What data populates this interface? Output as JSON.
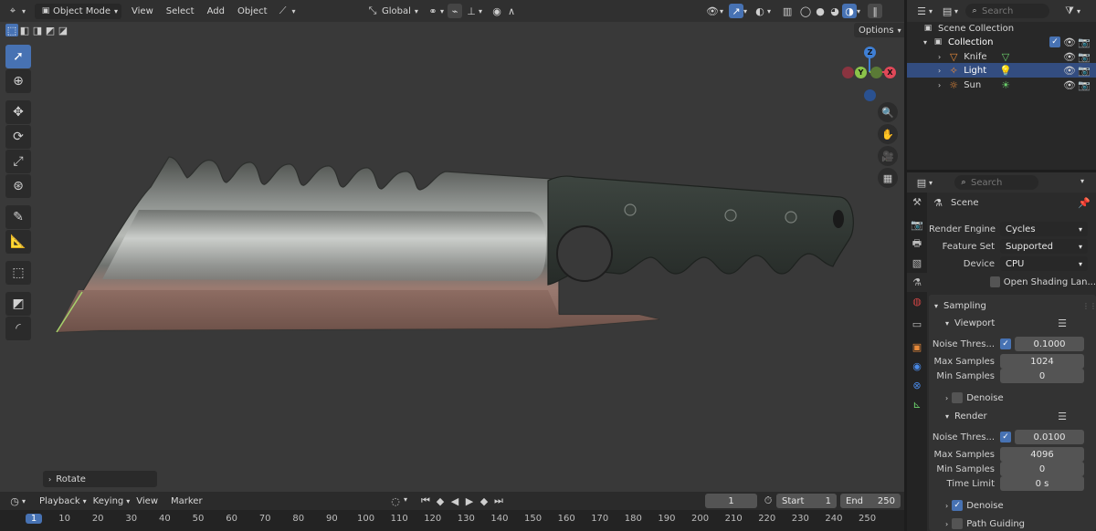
{
  "viewport": {
    "header": {
      "mode_label": "Object Mode",
      "menus": [
        "View",
        "Select",
        "Add",
        "Object"
      ],
      "orientation_label": "Global"
    },
    "options_label": "Options",
    "last_operation": "Rotate"
  },
  "timeline": {
    "menus": [
      "Playback",
      "Keying",
      "View",
      "Marker"
    ],
    "current_frame": "1",
    "start_label": "Start",
    "start_value": "1",
    "end_label": "End",
    "end_value": "250",
    "ruler_ticks": [
      "1",
      "10",
      "20",
      "30",
      "40",
      "50",
      "60",
      "70",
      "80",
      "90",
      "100",
      "110",
      "120",
      "130",
      "140",
      "150",
      "160",
      "170",
      "180",
      "190",
      "200",
      "210",
      "220",
      "230",
      "240",
      "250"
    ]
  },
  "outliner": {
    "search_placeholder": "Search",
    "scene_collection": "Scene Collection",
    "collection": "Collection",
    "items": [
      {
        "name": "Knife",
        "selected": false
      },
      {
        "name": "Light",
        "selected": true
      },
      {
        "name": "Sun",
        "selected": false
      }
    ]
  },
  "properties": {
    "search_placeholder": "Search",
    "scene_title": "Scene",
    "render_engine_label": "Render Engine",
    "render_engine_value": "Cycles",
    "feature_set_label": "Feature Set",
    "feature_set_value": "Supported",
    "device_label": "Device",
    "device_value": "CPU",
    "osl_label": "Open Shading Lan...",
    "sampling_title": "Sampling",
    "viewport_title": "Viewport",
    "viewport_noise_label": "Noise Thres...",
    "viewport_noise_value": "0.1000",
    "viewport_max_label": "Max Samples",
    "viewport_max_value": "1024",
    "viewport_min_label": "Min Samples",
    "viewport_min_value": "0",
    "denoise_label": "Denoise",
    "render_title": "Render",
    "render_noise_label": "Noise Thres...",
    "render_noise_value": "0.0100",
    "render_max_label": "Max Samples",
    "render_max_value": "4096",
    "render_min_label": "Min Samples",
    "render_min_value": "0",
    "time_limit_label": "Time Limit",
    "time_limit_value": "0 s",
    "render_denoise_label": "Denoise",
    "path_guiding_label": "Path Guiding"
  },
  "colors": {
    "accent": "#4772b3",
    "x_axis": "#e04858",
    "y_axis": "#8bc34a",
    "z_axis": "#3f7fd4"
  }
}
